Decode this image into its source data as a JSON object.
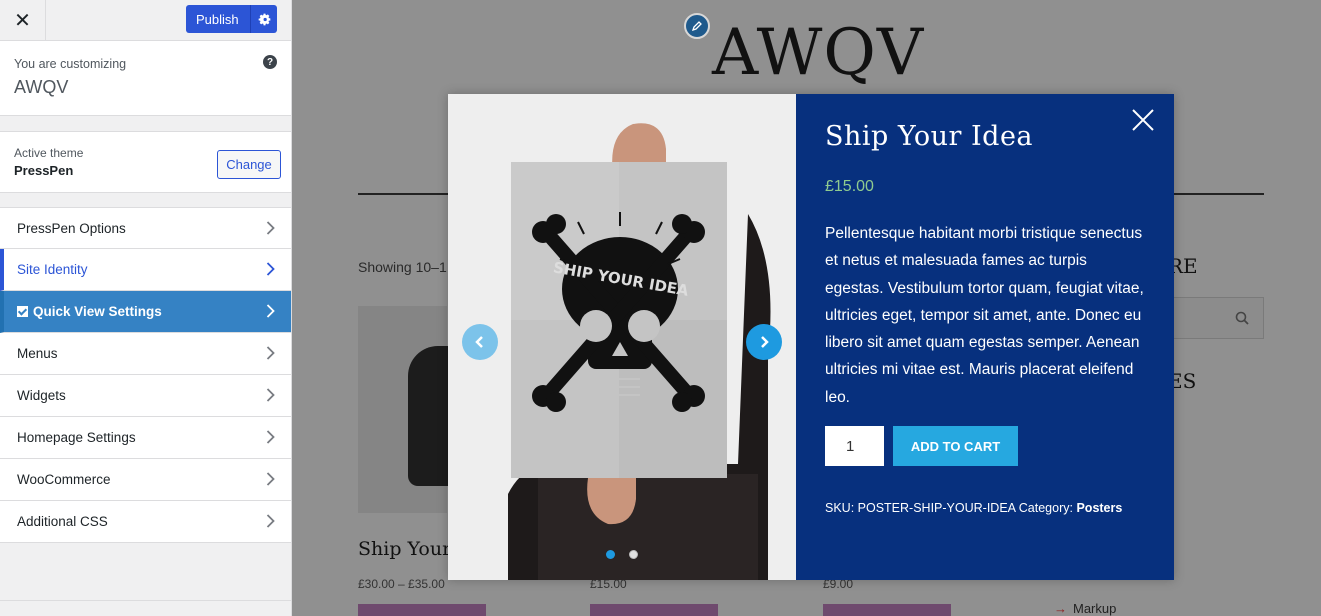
{
  "customizer": {
    "close_label": "✕",
    "publish_label": "Publish",
    "customizing_label": "You are customizing",
    "site_name": "AWQV",
    "help_label": "?",
    "active_theme_label": "Active theme",
    "theme_name": "PressPen",
    "change_label": "Change",
    "menu": [
      {
        "label": "PressPen Options"
      },
      {
        "label": "Site Identity"
      },
      {
        "label": "Quick View Settings"
      },
      {
        "label": "Menus"
      },
      {
        "label": "Widgets"
      },
      {
        "label": "Homepage Settings"
      },
      {
        "label": "WooCommerce"
      },
      {
        "label": "Additional CSS"
      }
    ]
  },
  "preview": {
    "site_title": "AWQV",
    "showing_text": "Showing 10–1",
    "product1_title": "Ship Your",
    "product1_price": "£30.00 – £35.00",
    "product2_price": "£15.00",
    "product3_price": "£9.00",
    "sidebar_heading1": "RE",
    "sidebar_heading2": "ES",
    "markup_link": "Markup"
  },
  "quick_view": {
    "title": "Ship Your Idea",
    "price": "£15.00",
    "description": "Pellentesque habitant morbi tristique senectus et netus et malesuada fames ac turpis egestas. Vestibulum tortor quam, feugiat vitae, ultricies eget, tempor sit amet, ante. Donec eu libero sit amet quam egestas semper. Aenean ultricies mi vitae est. Mauris placerat eleifend leo.",
    "quantity": "1",
    "add_to_cart_label": "ADD TO CART",
    "sku_text": "SKU: POSTER-SHIP-YOUR-IDEA Category:",
    "category": "Posters",
    "poster_text": "SHIP YOUR IDEA",
    "slide_count": 2,
    "active_slide": 1
  },
  "colors": {
    "publish": "#2c55d6",
    "active_item": "#3582c4",
    "modal_bg": "#07307e",
    "price_green": "#8fcb8f",
    "add_to_cart": "#26a8e0"
  }
}
